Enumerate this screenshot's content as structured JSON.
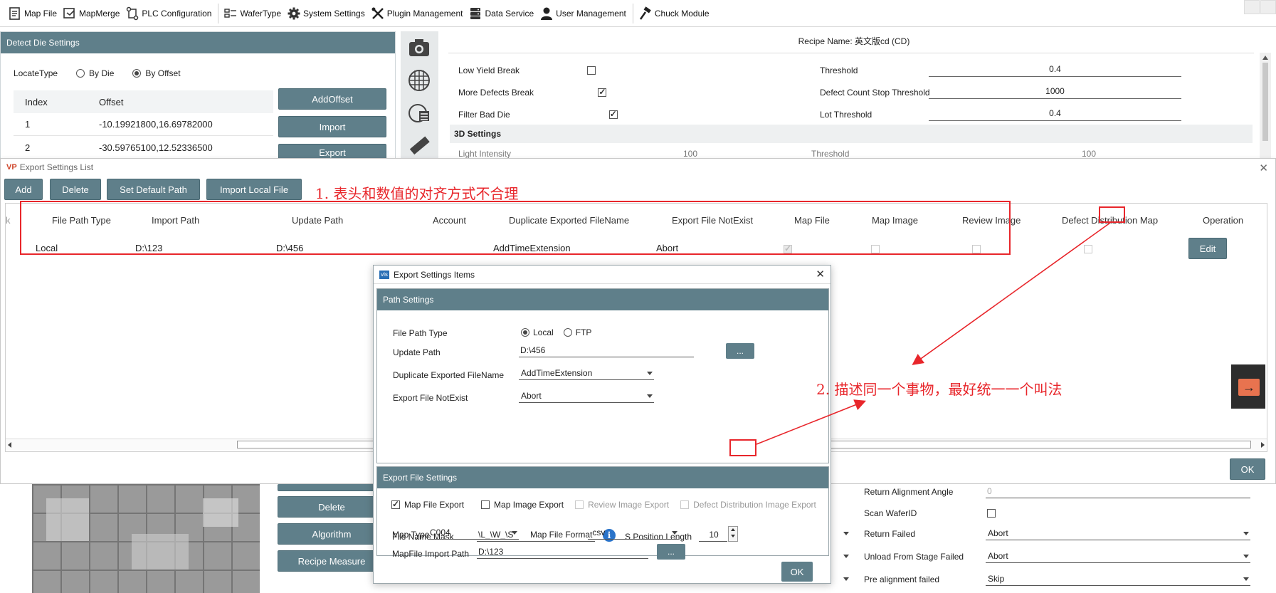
{
  "toolbar": {
    "items": [
      {
        "label": "Map File",
        "icon": "map-file-icon"
      },
      {
        "label": "MapMerge",
        "icon": "map-merge-icon"
      },
      {
        "label": "PLC Configuration",
        "icon": "plc-config-icon"
      },
      {
        "label": "WaferType",
        "icon": "wafer-type-icon"
      },
      {
        "label": "System Settings",
        "icon": "gear-icon"
      },
      {
        "label": "Plugin Management",
        "icon": "tools-icon"
      },
      {
        "label": "Data Service",
        "icon": "data-service-icon"
      },
      {
        "label": "User Management",
        "icon": "user-icon"
      },
      {
        "label": "Chuck Module",
        "icon": "hammer-icon"
      }
    ]
  },
  "detect_die": {
    "title": "Detect Die Settings",
    "locate_type_label": "LocateType",
    "option_by_die": "By Die",
    "option_by_offset": "By Offset",
    "col_index": "Index",
    "col_offset": "Offset",
    "rows": [
      {
        "index": "1",
        "offset": "-10.19921800,16.69782000"
      },
      {
        "index": "2",
        "offset": "-30.59765100,12.52336500"
      }
    ],
    "btn_add_offset": "AddOffset",
    "btn_import": "Import",
    "btn_export": "Export"
  },
  "recipe": {
    "name_label": "Recipe Name: 英文版cd (CD)",
    "rows": [
      {
        "label": "Low Yield Break",
        "checked": false,
        "right_label": "Threshold",
        "right_value": "0.4"
      },
      {
        "label": "More Defects Break",
        "checked": true,
        "right_label": "Defect Count Stop Threshold",
        "right_value": "1000"
      },
      {
        "label": "Filter Bad Die",
        "checked": true,
        "right_label": "Lot Threshold",
        "right_value": "0.4"
      }
    ],
    "section_3d": "3D Settings",
    "partial_left": "Light Intensity",
    "partial_left_value": "100",
    "partial_right": "Threshold",
    "partial_right_value": "100"
  },
  "export_list": {
    "title": "Export Settings List",
    "btn_add": "Add",
    "btn_delete": "Delete",
    "btn_set_default": "Set Default Path",
    "btn_import_local": "Import Local File",
    "headers": [
      "k",
      "File Path Type",
      "Import Path",
      "Update Path",
      "Account",
      "Duplicate Exported FileName",
      "Export File NotExist",
      "Map File",
      "Map Image",
      "Review Image",
      "Defect Distribution Map",
      "Operation"
    ],
    "row": {
      "file_path_type": "Local",
      "import_path": "D:\\123",
      "update_path": "D:\\456",
      "account": "",
      "duplicate": "AddTimeExtension",
      "not_exist": "Abort",
      "map_file": true,
      "map_image": false,
      "review_image": false,
      "defect_map": false,
      "edit_label": "Edit"
    },
    "ok_label": "OK"
  },
  "export_items": {
    "title": "Export Settings Items",
    "path_section": "Path Settings",
    "file_path_type_label": "File Path Type",
    "opt_local": "Local",
    "opt_ftp": "FTP",
    "update_path_label": "Update Path",
    "update_path_value": "D:\\456",
    "browse_label": "...",
    "duplicate_label": "Duplicate Exported FileName",
    "duplicate_value": "AddTimeExtension",
    "not_exist_label": "Export File NotExist",
    "not_exist_value": "Abort",
    "file_section": "Export File Settings",
    "map_file_export": "Map File Export",
    "map_image_export": "Map Image Export",
    "review_image_export": "Review Image Export",
    "defect_image_export": "Defect Distribution Image Export",
    "file_name_mask_label": "File Name Mask",
    "file_name_mask_value": "\\L_\\W_\\S",
    "s_position_label": "S Position Length",
    "s_position_value": "10",
    "mapfile_import_label": "MapFile Import Path",
    "mapfile_import_value": "D:\\123",
    "map_type_label": "Map Type",
    "map_type_value": "C004",
    "map_format_label": "Map File Format",
    "map_format_value": ".csv",
    "ok_label": "OK"
  },
  "bottom": {
    "btn_delete": "Delete",
    "btn_algorithm": "Algorithm",
    "btn_recipe_measure": "Recipe Measure",
    "return_alignment_label": "Return Alignment Angle",
    "return_alignment_value": "0",
    "scan_wafer_label": "Scan WaferID",
    "return_failed_label": "Return Failed",
    "return_failed_value": "Abort",
    "unload_failed_label": "Unload From Stage Failed",
    "unload_failed_value": "Abort",
    "prealign_failed_label": "Pre alignment failed",
    "prealign_failed_value": "Skip"
  },
  "annotations": {
    "note1": "1. 表头和数值的对齐方式不合理",
    "note2": "2. 描述同一个事物，最好统一一个叫法",
    "color": "#e8262b"
  }
}
